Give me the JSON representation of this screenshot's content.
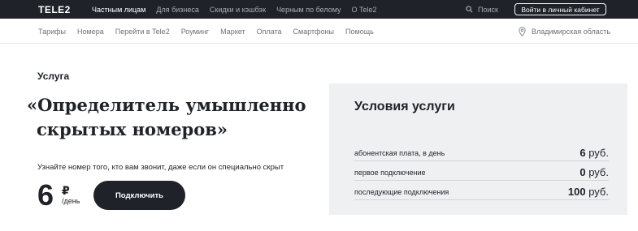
{
  "header": {
    "logo": "TELE2",
    "nav": [
      {
        "label": "Частным лицам",
        "active": true
      },
      {
        "label": "Для бизнеса",
        "active": false
      },
      {
        "label": "Скидки и кэшбэк",
        "active": false
      },
      {
        "label": "Черным по белому",
        "active": false
      },
      {
        "label": "О Tele2",
        "active": false
      }
    ],
    "search_label": "Поиск",
    "login_label": "Войти в личный кабинет"
  },
  "subnav": {
    "items": [
      "Тарифы",
      "Номера",
      "Перейти в Tele2",
      "Роуминг",
      "Маркет",
      "Оплата",
      "Смартфоны",
      "Помощь"
    ],
    "region": "Владимирская область"
  },
  "service": {
    "kicker": "Услуга",
    "title_line1": "«Определитель умышленно",
    "title_line2": "скрытых номеров»",
    "description": "Узнайте номер того, кто вам звонит, даже если он специально скрыт",
    "price": "6",
    "currency": "₽",
    "price_unit": "/день",
    "connect_label": "Подключить"
  },
  "conditions": {
    "title": "Условия услуги",
    "rows": [
      {
        "label": "абонентская плата, в день",
        "amount": "6",
        "unit": "руб."
      },
      {
        "label": "первое подключение",
        "amount": "0",
        "unit": "руб."
      },
      {
        "label": "последующие подключения",
        "amount": "100",
        "unit": "руб."
      }
    ]
  },
  "colors": {
    "dark": "#1f2229",
    "card_bg": "#eef0f2",
    "muted_text": "#6d7079"
  }
}
